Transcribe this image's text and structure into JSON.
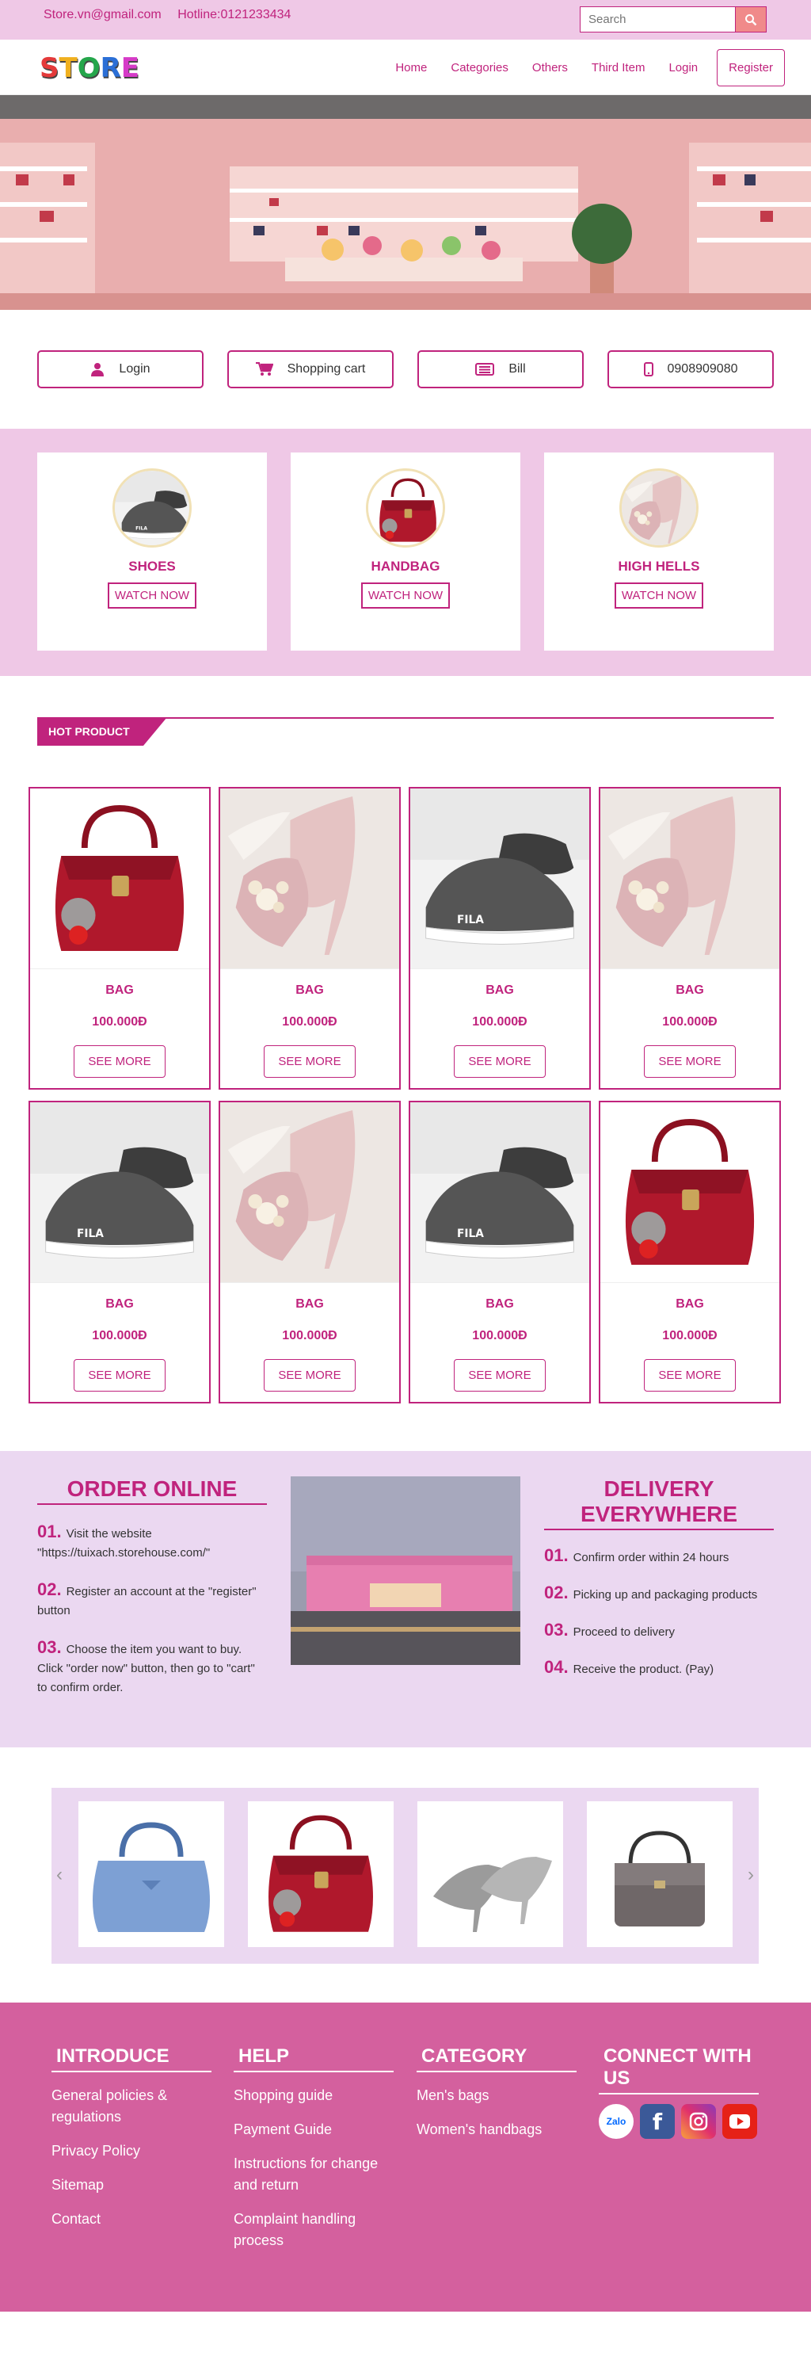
{
  "topbar": {
    "email": "Store.vn@gmail.com",
    "hotline": "Hotline:0121233434",
    "search_placeholder": "Search"
  },
  "logo": {
    "letters": [
      "S",
      "T",
      "O",
      "R",
      "E"
    ],
    "colors": [
      "#e43a3a",
      "#f0b01e",
      "#25a64b",
      "#2b6fd6",
      "#d63ac8"
    ]
  },
  "nav": {
    "items": [
      "Home",
      "Categories",
      "Others",
      "Third Item",
      "Login"
    ],
    "register": "Register"
  },
  "quick_links": [
    {
      "label": "Login",
      "icon": "user-icon"
    },
    {
      "label": "Shopping cart",
      "icon": "cart-icon"
    },
    {
      "label": "Bill",
      "icon": "bill-icon"
    },
    {
      "label": "0908909080",
      "icon": "phone-icon"
    }
  ],
  "categories": [
    {
      "name": "SHOES",
      "button": "WATCH NOW",
      "image": "sneaker"
    },
    {
      "name": "HANDBAG",
      "button": "WATCH NOW",
      "image": "red-handbag"
    },
    {
      "name": "HIGH HELLS",
      "button": "WATCH NOW",
      "image": "high-heel"
    }
  ],
  "hot_product": {
    "title": "HOT PRODUCT",
    "products": [
      {
        "name": "BAG",
        "price": "100.000Đ",
        "button": "SEE MORE",
        "image": "red-handbag"
      },
      {
        "name": "BAG",
        "price": "100.000Đ",
        "button": "SEE MORE",
        "image": "high-heel"
      },
      {
        "name": "BAG",
        "price": "100.000Đ",
        "button": "SEE MORE",
        "image": "sneaker"
      },
      {
        "name": "BAG",
        "price": "100.000Đ",
        "button": "SEE MORE",
        "image": "high-heel"
      },
      {
        "name": "BAG",
        "price": "100.000Đ",
        "button": "SEE MORE",
        "image": "sneaker"
      },
      {
        "name": "BAG",
        "price": "100.000Đ",
        "button": "SEE MORE",
        "image": "high-heel"
      },
      {
        "name": "BAG",
        "price": "100.000Đ",
        "button": "SEE MORE",
        "image": "sneaker"
      },
      {
        "name": "BAG",
        "price": "100.000Đ",
        "button": "SEE MORE",
        "image": "red-handbag"
      }
    ]
  },
  "order_online": {
    "title": "ORDER ONLINE",
    "steps": [
      {
        "num": "01.",
        "text": "Visit the website \"https://tuixach.storehouse.com/\""
      },
      {
        "num": "02.",
        "text": "Register an account at the \"register\" button"
      },
      {
        "num": "03.",
        "text": "Choose the item you want to buy. Click \"order now\" button, then go to \"cart\" to confirm order."
      }
    ]
  },
  "delivery": {
    "title": "DELIVERY EVERYWHERE",
    "steps": [
      {
        "num": "01.",
        "text": "Confirm order within 24 hours"
      },
      {
        "num": "02.",
        "text": "Picking up and packaging products"
      },
      {
        "num": "03.",
        "text": "Proceed to delivery"
      },
      {
        "num": "04.",
        "text": "Receive the product. (Pay)"
      }
    ]
  },
  "carousel": {
    "items": [
      "blue-handbag",
      "red-handbag",
      "silver-heels",
      "snakeskin-bag"
    ]
  },
  "footer": {
    "columns": [
      {
        "title": "INTRODUCE",
        "links": [
          "General policies & regulations",
          "Privacy Policy",
          "Sitemap",
          "Contact"
        ]
      },
      {
        "title": "HELP",
        "links": [
          "Shopping guide",
          "Payment Guide",
          "Instructions for change and return",
          "Complaint handling process"
        ]
      },
      {
        "title": "CATEGORY",
        "links": [
          "Men's bags",
          "Women's handbags"
        ]
      },
      {
        "title": "CONNECT WITH US",
        "links": []
      }
    ],
    "socials": [
      {
        "name": "zalo-icon",
        "label": "Zalo",
        "color": "#ffffff"
      },
      {
        "name": "facebook-icon",
        "label": "f",
        "color": "#3b5998"
      },
      {
        "name": "instagram-icon",
        "label": "",
        "color": "#e1306c"
      },
      {
        "name": "youtube-icon",
        "label": "",
        "color": "#e62117"
      }
    ]
  },
  "colors": {
    "accent": "#c0237d",
    "pink_bg": "#efc8e6",
    "lavender_bg": "#ebd8f1",
    "footer_bg": "#d4609e"
  }
}
